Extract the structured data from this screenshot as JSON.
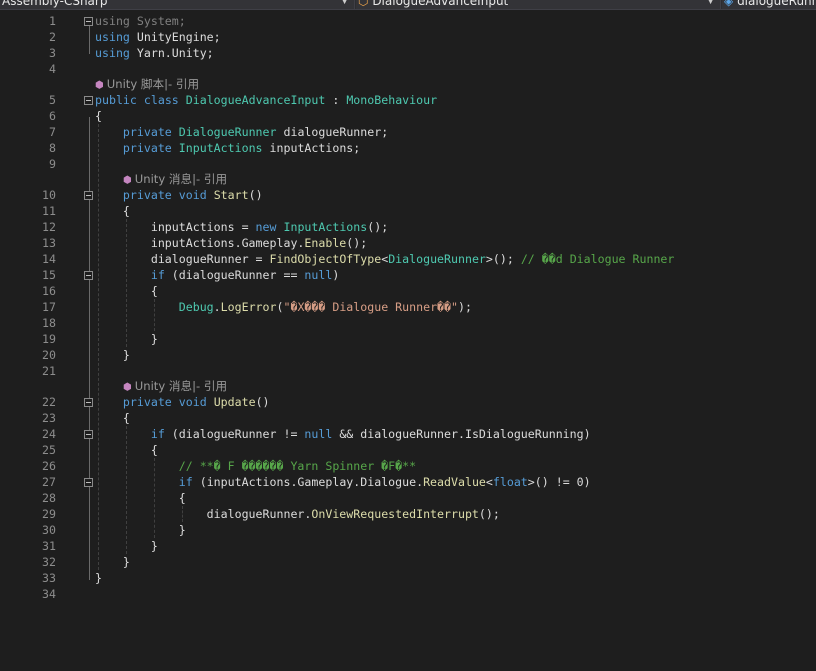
{
  "toolbar": {
    "project_dropdown": "Assembly-CSharp",
    "class_dropdown": "DialogueAdvanceInput",
    "member_dropdown": "dialogueRunner"
  },
  "codelens": {
    "script_ref": "Unity 脚本|- 引用",
    "message_ref": "Unity 消息|- 引用"
  },
  "lines": [
    {
      "n": "1",
      "code": [
        [
          "kw dim",
          "using"
        ],
        [
          "id dim",
          " System;"
        ]
      ]
    },
    {
      "n": "2",
      "code": [
        [
          "kw",
          "using"
        ],
        [
          "id",
          " UnityEngine;"
        ]
      ]
    },
    {
      "n": "3",
      "code": [
        [
          "kw",
          "using"
        ],
        [
          "id",
          " Yarn.Unity;"
        ]
      ]
    },
    {
      "n": "4",
      "code": []
    },
    {
      "n": "5",
      "code": [
        [
          "kw",
          "public"
        ],
        [
          "id",
          " "
        ],
        [
          "kw",
          "class"
        ],
        [
          "id",
          " "
        ],
        [
          "ty",
          "DialogueAdvanceInput"
        ],
        [
          "id",
          " : "
        ],
        [
          "ty",
          "MonoBehaviour"
        ]
      ]
    },
    {
      "n": "6",
      "code": [
        [
          "id",
          "{"
        ]
      ]
    },
    {
      "n": "7",
      "code": [
        [
          "id",
          "    "
        ],
        [
          "kw",
          "private"
        ],
        [
          "id",
          " "
        ],
        [
          "ty",
          "DialogueRunner"
        ],
        [
          "id",
          " dialogueRunner;"
        ]
      ]
    },
    {
      "n": "8",
      "code": [
        [
          "id",
          "    "
        ],
        [
          "kw",
          "private"
        ],
        [
          "id",
          " "
        ],
        [
          "ty",
          "InputActions"
        ],
        [
          "id",
          " inputActions;"
        ]
      ]
    },
    {
      "n": "9",
      "code": []
    },
    {
      "n": "10",
      "code": [
        [
          "id",
          "    "
        ],
        [
          "kw",
          "private"
        ],
        [
          "id",
          " "
        ],
        [
          "kw",
          "void"
        ],
        [
          "id",
          " "
        ],
        [
          "fn",
          "Start"
        ],
        [
          "id",
          "()"
        ]
      ]
    },
    {
      "n": "11",
      "code": [
        [
          "id",
          "    {"
        ]
      ]
    },
    {
      "n": "12",
      "code": [
        [
          "id",
          "        inputActions = "
        ],
        [
          "kw",
          "new"
        ],
        [
          "id",
          " "
        ],
        [
          "ty",
          "InputActions"
        ],
        [
          "id",
          "();"
        ]
      ]
    },
    {
      "n": "13",
      "code": [
        [
          "id",
          "        inputActions.Gameplay."
        ],
        [
          "fn",
          "Enable"
        ],
        [
          "id",
          "();"
        ]
      ]
    },
    {
      "n": "14",
      "code": [
        [
          "id",
          "        dialogueRunner = "
        ],
        [
          "fn",
          "FindObjectOfType"
        ],
        [
          "id",
          "<"
        ],
        [
          "ty",
          "DialogueRunner"
        ],
        [
          "id",
          ">(); "
        ],
        [
          "cm",
          "// ��d Dialogue Runner"
        ]
      ]
    },
    {
      "n": "15",
      "code": [
        [
          "id",
          "        "
        ],
        [
          "kw",
          "if"
        ],
        [
          "id",
          " (dialogueRunner == "
        ],
        [
          "kw",
          "null"
        ],
        [
          "id",
          ")"
        ]
      ]
    },
    {
      "n": "16",
      "code": [
        [
          "id",
          "        {"
        ]
      ]
    },
    {
      "n": "17",
      "code": [
        [
          "id",
          "            "
        ],
        [
          "ty",
          "Debug"
        ],
        [
          "id",
          "."
        ],
        [
          "fn",
          "LogError"
        ],
        [
          "id",
          "("
        ],
        [
          "st",
          "\"�X��� Dialogue Runner��\""
        ],
        [
          "id",
          ");"
        ]
      ]
    },
    {
      "n": "18",
      "code": []
    },
    {
      "n": "19",
      "code": [
        [
          "id",
          "        }"
        ]
      ]
    },
    {
      "n": "20",
      "code": [
        [
          "id",
          "    }"
        ]
      ]
    },
    {
      "n": "21",
      "code": []
    },
    {
      "n": "22",
      "code": [
        [
          "id",
          "    "
        ],
        [
          "kw",
          "private"
        ],
        [
          "id",
          " "
        ],
        [
          "kw",
          "void"
        ],
        [
          "id",
          " "
        ],
        [
          "fn",
          "Update"
        ],
        [
          "id",
          "()"
        ]
      ]
    },
    {
      "n": "23",
      "code": [
        [
          "id",
          "    {"
        ]
      ]
    },
    {
      "n": "24",
      "code": [
        [
          "id",
          "        "
        ],
        [
          "kw",
          "if"
        ],
        [
          "id",
          " (dialogueRunner != "
        ],
        [
          "kw",
          "null"
        ],
        [
          "id",
          " && dialogueRunner.IsDialogueRunning)"
        ]
      ]
    },
    {
      "n": "25",
      "code": [
        [
          "id",
          "        {"
        ]
      ]
    },
    {
      "n": "26",
      "code": [
        [
          "id",
          "            "
        ],
        [
          "cm",
          "// **� F ������ Yarn Spinner �F�**"
        ]
      ]
    },
    {
      "n": "27",
      "code": [
        [
          "id",
          "            "
        ],
        [
          "kw",
          "if"
        ],
        [
          "id",
          " (inputActions.Gameplay.Dialogue."
        ],
        [
          "fn",
          "ReadValue"
        ],
        [
          "id",
          "<"
        ],
        [
          "kw",
          "float"
        ],
        [
          "id",
          ">() != 0)"
        ]
      ]
    },
    {
      "n": "28",
      "code": [
        [
          "id",
          "            {"
        ]
      ]
    },
    {
      "n": "29",
      "code": [
        [
          "id",
          "                dialogueRunner."
        ],
        [
          "fn",
          "OnViewRequestedInterrupt"
        ],
        [
          "id",
          "();"
        ]
      ]
    },
    {
      "n": "30",
      "code": [
        [
          "id",
          "            }"
        ]
      ]
    },
    {
      "n": "31",
      "code": [
        [
          "id",
          "        }"
        ]
      ]
    },
    {
      "n": "32",
      "code": [
        [
          "id",
          "    }"
        ]
      ]
    },
    {
      "n": "33",
      "code": [
        [
          "id",
          "}"
        ]
      ]
    },
    {
      "n": "34",
      "code": []
    }
  ]
}
